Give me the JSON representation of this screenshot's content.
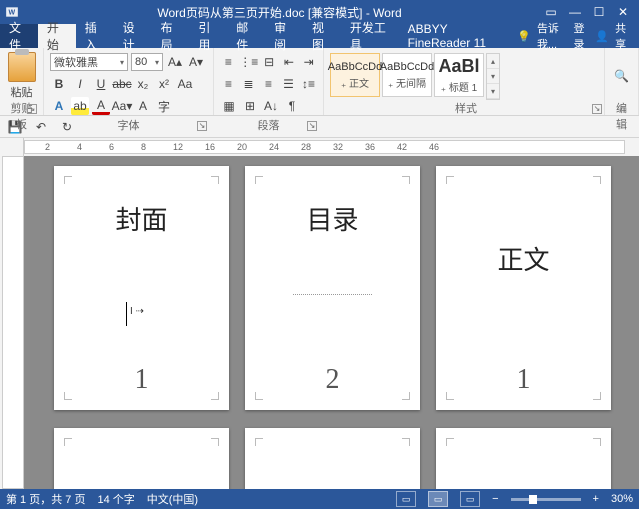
{
  "titlebar": {
    "title": "Word页码从第三页开始.doc [兼容模式] - Word"
  },
  "tabs": {
    "file": "文件",
    "home": "开始",
    "insert": "插入",
    "design": "设计",
    "layout": "布局",
    "references": "引用",
    "mailings": "邮件",
    "review": "审阅",
    "view": "视图",
    "developer": "开发工具",
    "finereader": "ABBYY FineReader 11",
    "tellme": "告诉我...",
    "signin": "登录",
    "share": "共享"
  },
  "ribbon": {
    "clipboard": {
      "label": "剪贴板",
      "paste": "粘贴"
    },
    "font": {
      "label": "字体",
      "name": "微软雅黑",
      "size": "80"
    },
    "paragraph": {
      "label": "段落"
    },
    "styles": {
      "label": "样式",
      "items": [
        {
          "preview": "AaBbCcDd",
          "name": "正文",
          "selected": true
        },
        {
          "preview": "AaBbCcDd",
          "name": "无间隔",
          "selected": false
        },
        {
          "preview": "AaBl",
          "name": "标题 1",
          "selected": false,
          "big": true
        }
      ]
    },
    "editing": {
      "label": "编辑"
    }
  },
  "ruler_h": [
    "2",
    "4",
    "6",
    "8",
    "12",
    "16",
    "20",
    "24",
    "28",
    "32",
    "36",
    "42",
    "46"
  ],
  "pages": [
    [
      {
        "title": "封面",
        "num": "1",
        "cursor": true
      },
      {
        "title": "目录",
        "num": "2",
        "dotline": true
      },
      {
        "title": "正文",
        "num": "1",
        "titleLow": true
      }
    ]
  ],
  "status": {
    "page": "第 1 页，共 7 页",
    "words": "14 个字",
    "lang": "中文(中国)",
    "zoom": "30%"
  }
}
